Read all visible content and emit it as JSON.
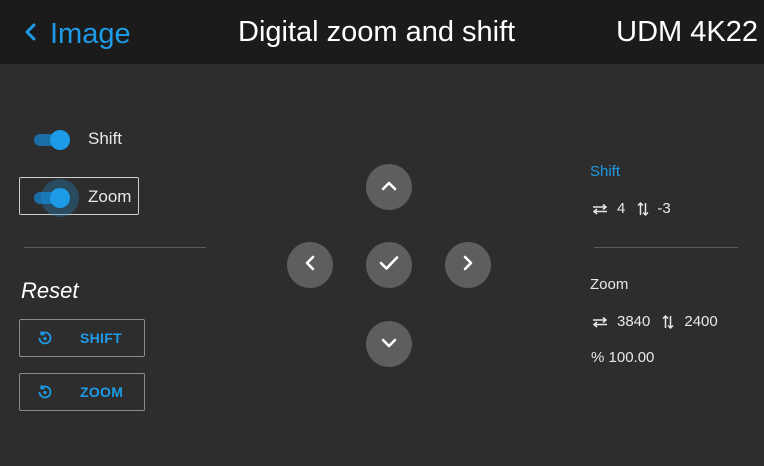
{
  "header": {
    "back_label": "Image",
    "title": "Digital zoom and shift",
    "device": "UDM 4K22"
  },
  "toggles": {
    "shift": {
      "label": "Shift",
      "on": true
    },
    "zoom": {
      "label": "Zoom",
      "on": true,
      "focused": true
    }
  },
  "reset": {
    "heading": "Reset",
    "shift_button": "SHIFT",
    "zoom_button": "ZOOM"
  },
  "dpad": {
    "up": "chevron-up-icon",
    "left": "chevron-left-icon",
    "ok": "checkmark-icon",
    "right": "chevron-right-icon",
    "down": "chevron-down-icon"
  },
  "info": {
    "shift": {
      "label": "Shift",
      "h": "4",
      "v": "-3"
    },
    "zoom": {
      "label": "Zoom",
      "h": "3840",
      "v": "2400",
      "percent": "% 100.00"
    }
  },
  "colors": {
    "accent": "#1e9be6",
    "background": "#2d2d2d",
    "topbar": "#1b1b1b",
    "button": "#5e5e5e"
  }
}
